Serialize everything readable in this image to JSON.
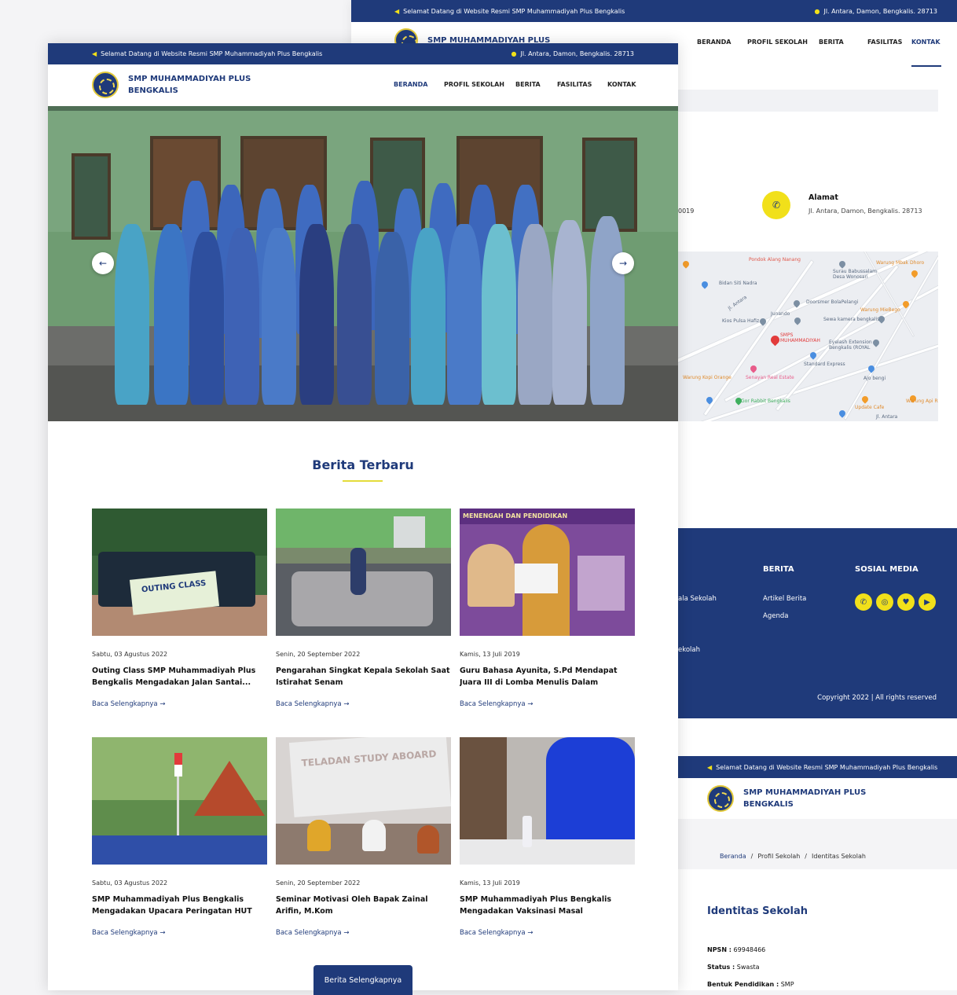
{
  "back_page": {
    "topbar": {
      "welcome": "Selamat Datang di Website Resmi SMP Muhammadiyah Plus Bengkalis",
      "address": "Jl. Antara, Damon, Bengkalis. 28713"
    },
    "brand": "SMP MUHAMMADIYAH PLUS",
    "nav": [
      "BERANDA",
      "PROFIL SEKOLAH",
      "BERITA",
      "FASILITAS",
      "KONTAK"
    ],
    "partial_value": "0019",
    "contact": {
      "label": "Alamat",
      "value": "Jl. Antara, Damon, Bengkalis. 28713"
    },
    "map_labels": [
      "Pondok Alang Nanang",
      "Warung Mbak Dhoro",
      "Surau Babussalam Desa Wonosari",
      "Bidan Siti Nadra",
      "Doorsmer BolaPelangi",
      "Warung MieBego",
      "Kios Pulsa Hafiz",
      "Junando",
      "Sewa kamera bengkalis",
      "SMPS MUHAMMADIYAH",
      "Eyelash Extension Bengkalis (ROYAL",
      "Standard Express",
      "Warung Kopi Orange",
      "Senayan Real Estate",
      "Ajo bengi",
      "Gor Rabbit Bengkalis",
      "Warung Api R",
      "Update Cafe",
      "Jl. Antara",
      "Jl. Antara"
    ]
  },
  "footer": {
    "col1_items": [
      "ala Sekolah",
      "ekolah"
    ],
    "berita_title": "BERITA",
    "berita_items": [
      "Artikel Berita",
      "Agenda"
    ],
    "social_title": "SOSIAL MEDIA",
    "social_icons": [
      "phone-icon",
      "instagram-icon",
      "twitter-icon",
      "youtube-icon"
    ],
    "copyright": "Copyright 2022 | All rights reserved"
  },
  "third_page": {
    "welcome": "Selamat Datang di Website Resmi SMP Muhammadiyah Plus Bengkalis",
    "brand_line1": "SMP MUHAMMADIYAH PLUS",
    "brand_line2": "BENGKALIS",
    "breadcrumb": [
      "Beranda",
      "Profil Sekolah",
      "Identitas Sekolah"
    ],
    "title": "Identitas Sekolah",
    "fields": [
      {
        "label": "NPSN :",
        "value": "69948466"
      },
      {
        "label": "Status :",
        "value": "Swasta"
      },
      {
        "label": "Bentuk Pendidikan :",
        "value": "SMP"
      }
    ]
  },
  "main_page": {
    "topbar": {
      "welcome": "Selamat Datang di Website Resmi SMP Muhammadiyah Plus Bengkalis",
      "address": "Jl. Antara, Damon, Bengkalis. 28713"
    },
    "brand_line1": "SMP MUHAMMADIYAH PLUS",
    "brand_line2": "BENGKALIS",
    "nav": [
      "BERANDA",
      "PROFIL SEKOLAH",
      "BERITA",
      "FASILITAS",
      "KONTAK"
    ],
    "active_nav": "BERANDA",
    "section_title": "Berita Terbaru",
    "read_more": "Baca Selengkapnya",
    "more_button": "Berita Selengkapnya",
    "news": [
      {
        "date": "Sabtu, 03 Agustus 2022",
        "title": "Outing Class SMP Muhammadiyah Plus Bengkalis Mengadakan Jalan Santai...",
        "banner": "OUTING CLASS"
      },
      {
        "date": "Senin, 20 September 2022",
        "title": "Pengarahan Singkat Kepala Sekolah Saat Istirahat Senam"
      },
      {
        "date": "Kamis, 13 Juli 2019",
        "title": "Guru Bahasa Ayunita, S.Pd Mendapat Juara III di Lomba Menulis Dalam Rangka...",
        "banner": "MENENGAH DAN PENDIDIKAN"
      },
      {
        "date": "Sabtu, 03 Agustus 2022",
        "title": "SMP Muhammadiyah Plus Bengkalis Mengadakan Upacara Peringatan HUT RI..."
      },
      {
        "date": "Senin, 20 September 2022",
        "title": "Seminar Motivasi Oleh Bapak Zainal Arifin, M.Kom",
        "banner": "TELADAN STUDY ABOARD"
      },
      {
        "date": "Kamis, 13 Juli 2019",
        "title": "SMP Muhammadiyah Plus Bengkalis Mengadakan Vaksinasi Masal"
      }
    ]
  },
  "colors": {
    "primary": "#1f3a7a",
    "accent": "#f1e01a"
  }
}
